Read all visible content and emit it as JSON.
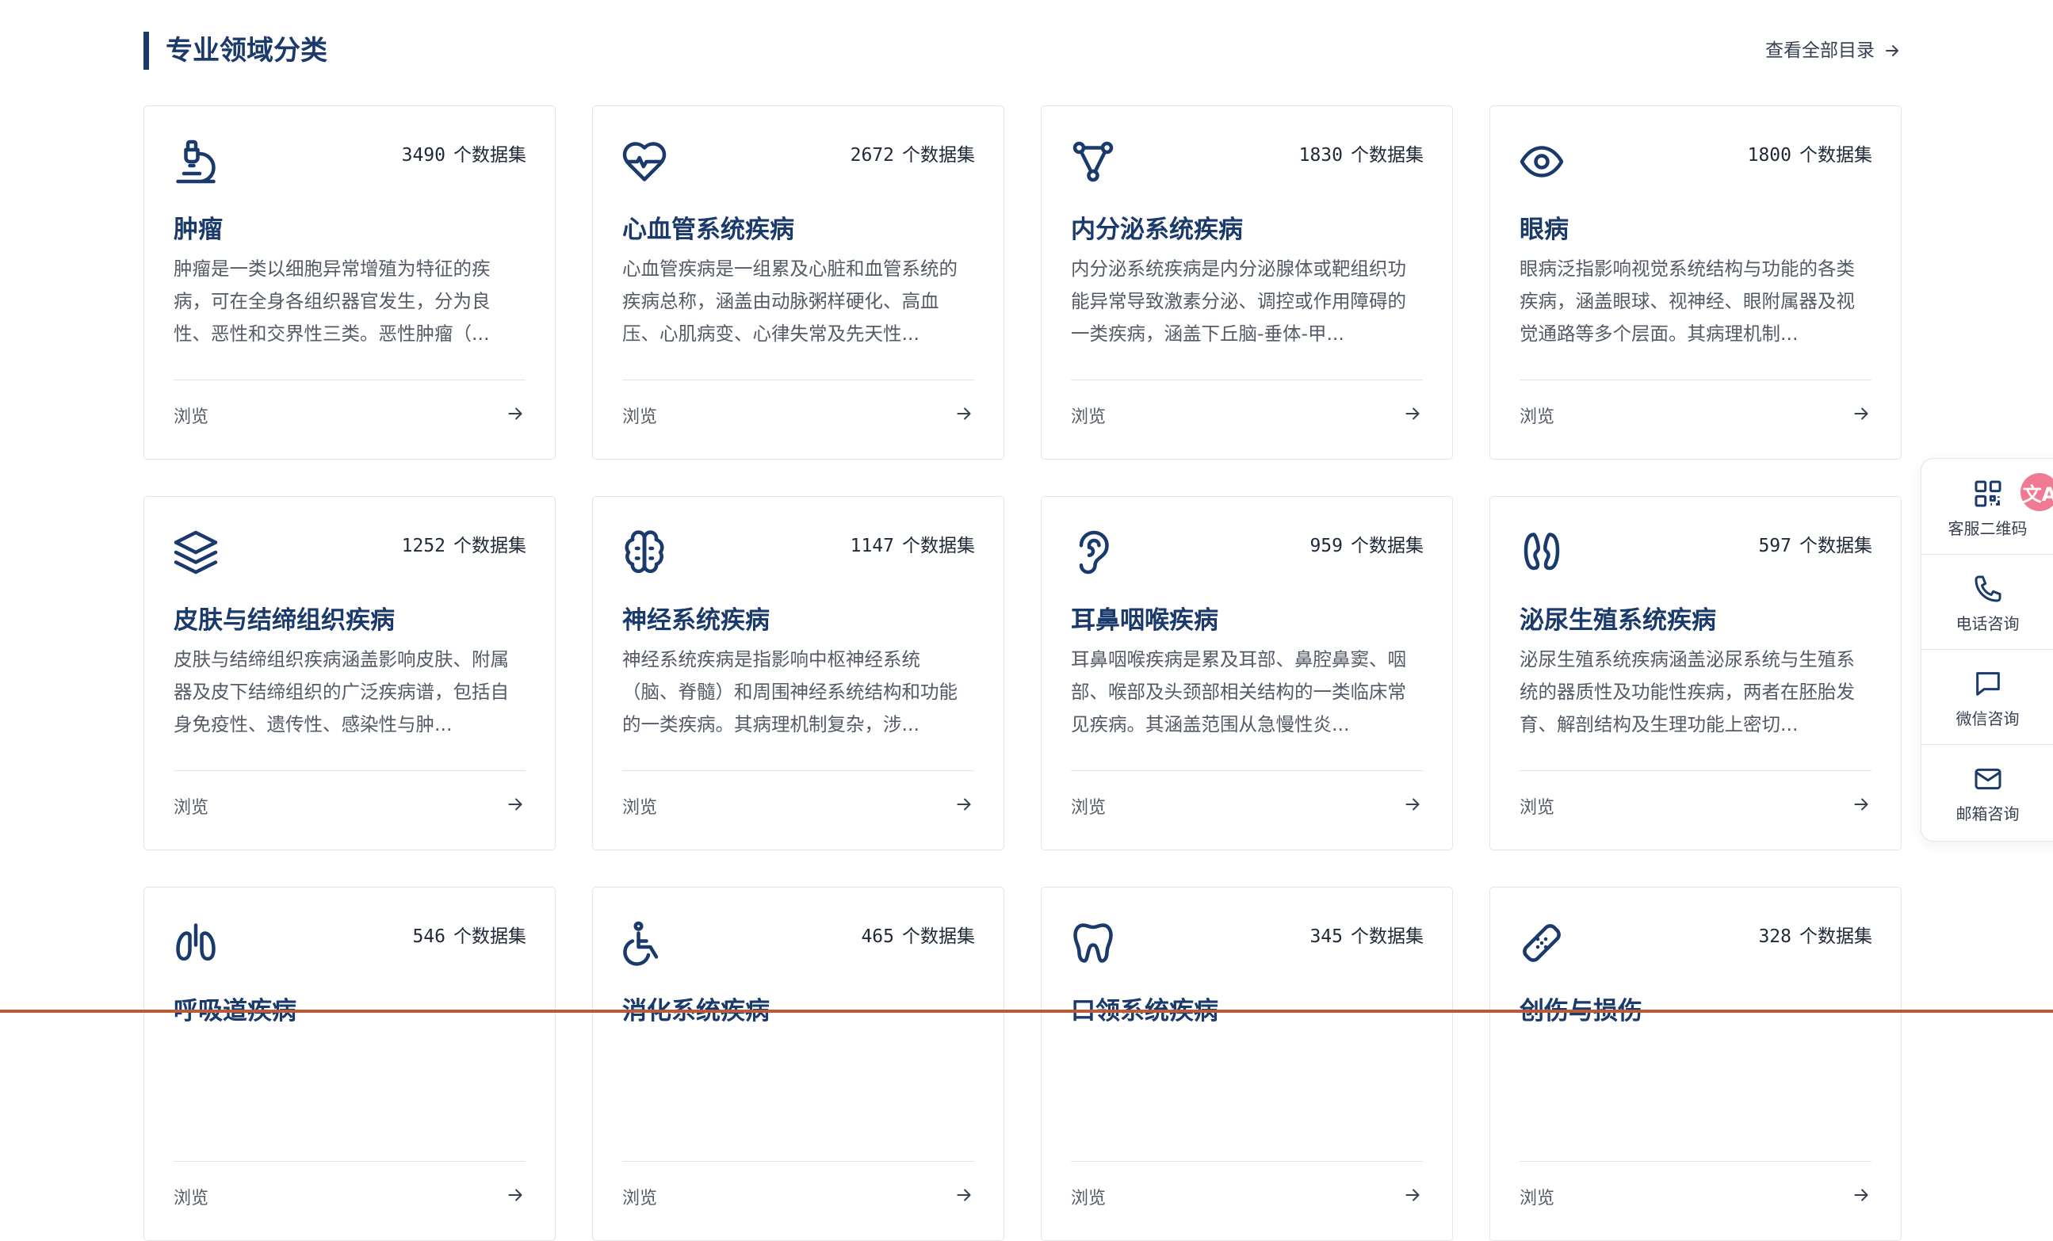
{
  "section": {
    "title": "专业领域分类",
    "view_all": "查看全部目录"
  },
  "cards": [
    {
      "icon": "microscope-icon",
      "count": "3490",
      "unit": "个数据集",
      "name": "肿瘤",
      "desc": "肿瘤是一类以细胞异常增殖为特征的疾病，可在全身各组织器官发生，分为良性、恶性和交界性三类。恶性肿瘤（...",
      "browse": "浏览"
    },
    {
      "icon": "heart-pulse-icon",
      "count": "2672",
      "unit": "个数据集",
      "name": "心血管系统疾病",
      "desc": "心血管疾病是一组累及心脏和血管系统的疾病总称，涵盖由动脉粥样硬化、高血压、心肌病变、心律失常及先天性...",
      "browse": "浏览"
    },
    {
      "icon": "network-icon",
      "count": "1830",
      "unit": "个数据集",
      "name": "内分泌系统疾病",
      "desc": "内分泌系统疾病是内分泌腺体或靶组织功能异常导致激素分泌、调控或作用障碍的一类疾病，涵盖下丘脑-垂体-甲...",
      "browse": "浏览"
    },
    {
      "icon": "eye-icon",
      "count": "1800",
      "unit": "个数据集",
      "name": "眼病",
      "desc": "眼病泛指影响视觉系统结构与功能的各类疾病，涵盖眼球、视神经、眼附属器及视觉通路等多个层面。其病理机制...",
      "browse": "浏览"
    },
    {
      "icon": "layers-icon",
      "count": "1252",
      "unit": "个数据集",
      "name": "皮肤与结缔组织疾病",
      "desc": "皮肤与结缔组织疾病涵盖影响皮肤、附属器及皮下结缔组织的广泛疾病谱，包括自身免疫性、遗传性、感染性与肿...",
      "browse": "浏览"
    },
    {
      "icon": "brain-icon",
      "count": "1147",
      "unit": "个数据集",
      "name": "神经系统疾病",
      "desc": "神经系统疾病是指影响中枢神经系统（脑、脊髓）和周围神经系统结构和功能的一类疾病。其病理机制复杂，涉...",
      "browse": "浏览"
    },
    {
      "icon": "ear-icon",
      "count": "959",
      "unit": "个数据集",
      "name": "耳鼻咽喉疾病",
      "desc": "耳鼻咽喉疾病是累及耳部、鼻腔鼻窦、咽部、喉部及头颈部相关结构的一类临床常见疾病。其涵盖范围从急慢性炎...",
      "browse": "浏览"
    },
    {
      "icon": "kidney-icon",
      "count": "597",
      "unit": "个数据集",
      "name": "泌尿生殖系统疾病",
      "desc": "泌尿生殖系统疾病涵盖泌尿系统与生殖系统的器质性及功能性疾病，两者在胚胎发育、解剖结构及生理功能上密切...",
      "browse": "浏览"
    },
    {
      "icon": "lungs-icon",
      "count": "546",
      "unit": "个数据集",
      "name": "呼吸道疾病",
      "desc": "",
      "browse": "浏览"
    },
    {
      "icon": "wheelchair-icon",
      "count": "465",
      "unit": "个数据集",
      "name": "消化系统疾病",
      "desc": "",
      "browse": "浏览"
    },
    {
      "icon": "tooth-icon",
      "count": "345",
      "unit": "个数据集",
      "name": "口领系统疾病",
      "desc": "",
      "browse": "浏览"
    },
    {
      "icon": "bandage-icon",
      "count": "328",
      "unit": "个数据集",
      "name": "创伤与损伤",
      "desc": "",
      "browse": "浏览"
    }
  ],
  "float_panel": {
    "qr": "客服二维码",
    "phone": "电话咨询",
    "wechat": "微信咨询",
    "email": "邮箱咨询",
    "translate_badge": "文A"
  },
  "colors": {
    "primary": "#1a3a6b",
    "text_muted": "#555b66",
    "border": "#e2e4e8",
    "badge": "#f07a93"
  }
}
